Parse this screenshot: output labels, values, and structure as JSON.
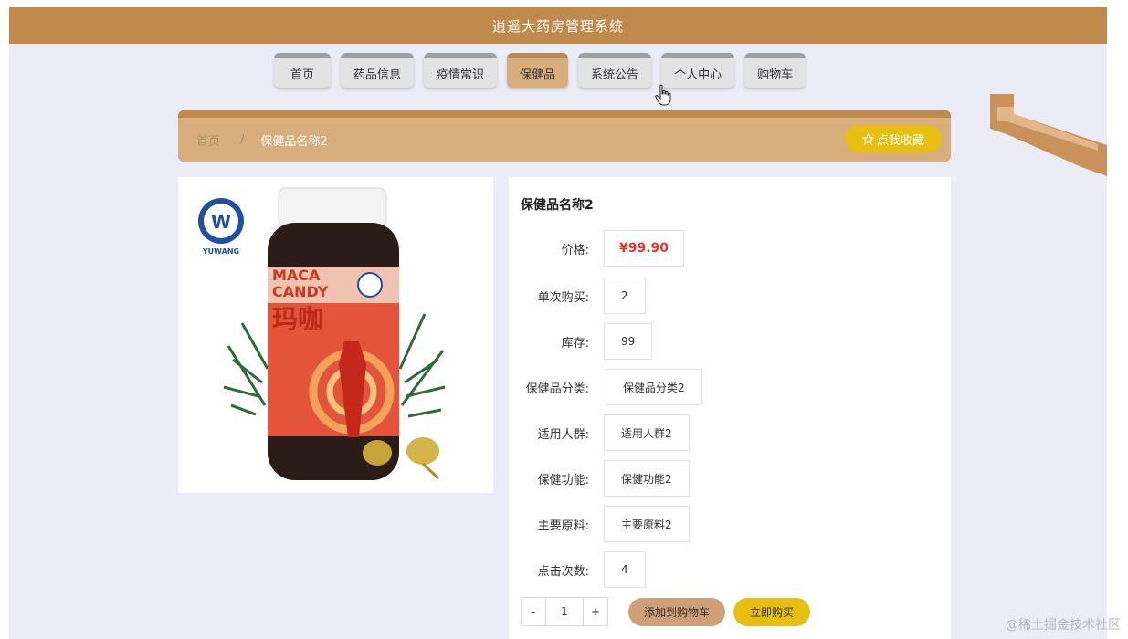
{
  "header": {
    "title": "逍遥大药房管理系统"
  },
  "nav": {
    "tabs": [
      {
        "label": "首页",
        "active": false
      },
      {
        "label": "药品信息",
        "active": false
      },
      {
        "label": "疫情常识",
        "active": false
      },
      {
        "label": "保健品",
        "active": true
      },
      {
        "label": "系统公告",
        "active": false
      },
      {
        "label": "个人中心",
        "active": false
      },
      {
        "label": "购物车",
        "active": false
      }
    ]
  },
  "breadcrumb": {
    "home": "首页",
    "separator": "/",
    "current": "保健品名称2"
  },
  "favorite_button": {
    "icon": "star-outline-icon",
    "label": "点我收藏"
  },
  "product_image": {
    "brand_text": "YUWANG",
    "label_line1": "MACA",
    "label_line2": "CANDY",
    "label_cn": "玛咖"
  },
  "product": {
    "title": "保健品名称2",
    "fields": [
      {
        "label": "价格:",
        "value": "¥99.90",
        "type": "price"
      },
      {
        "label": "单次购买:",
        "value": "2"
      },
      {
        "label": "库存:",
        "value": "99"
      },
      {
        "label": "保健品分类:",
        "value": "保健品分类2"
      },
      {
        "label": "适用人群:",
        "value": "适用人群2"
      },
      {
        "label": "保健功能:",
        "value": "保健功能2"
      },
      {
        "label": "主要原料:",
        "value": "主要原料2"
      },
      {
        "label": "点击次数:",
        "value": "4"
      }
    ]
  },
  "quantity": {
    "minus": "-",
    "value": "1",
    "plus": "+"
  },
  "actions": {
    "add_to_cart": "添加到购物车",
    "buy_now": "立即购买"
  },
  "watermark": "@稀土掘金技术社区",
  "colors": {
    "brand": "#c08a4a",
    "tab_active": "#d9ae7d",
    "accent_yellow": "#e8be12",
    "price_red": "#e8322a"
  }
}
